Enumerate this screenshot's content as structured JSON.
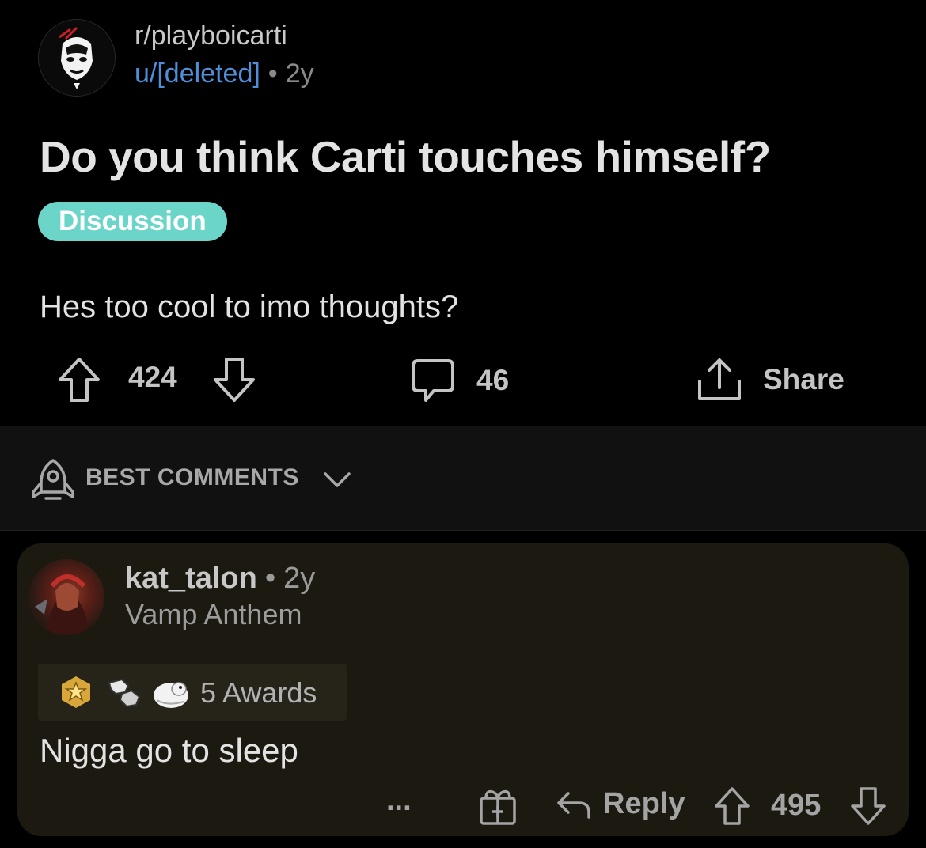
{
  "post": {
    "subreddit": "r/playboicarti",
    "author": "u/[deleted]",
    "separator": "•",
    "age": "2y",
    "title": "Do you think Carti touches himself?",
    "flair": "Discussion",
    "body": "Hes too cool to imo thoughts?",
    "upvotes": "424",
    "comments": "46",
    "share_label": "Share"
  },
  "sort": {
    "label": "BEST COMMENTS"
  },
  "comment": {
    "author": "kat_talon",
    "separator": "•",
    "age": "2y",
    "user_flair": "Vamp Anthem",
    "awards_label": "5 Awards",
    "body": "Nigga go to sleep",
    "more_label": "...",
    "reply_label": "Reply",
    "score": "495"
  },
  "colors": {
    "background": "#000000",
    "flair_bg": "#6ad5c8",
    "username_link": "#4f8fd8",
    "comment_bg": "#1b1910",
    "sort_bar_bg": "#111111"
  },
  "icons": {
    "subreddit_avatar": "subreddit-avatar-icon",
    "upvote": "arrow-up-icon",
    "downvote": "arrow-down-icon",
    "comments": "comment-bubble-icon",
    "share": "share-icon",
    "sort": "rocket-icon",
    "sort_toggle": "chevron-down-icon",
    "award_1": "gold-star-award-icon",
    "award_2": "fist-bump-award-icon",
    "award_3": "seal-award-icon",
    "gift": "gift-icon",
    "reply": "reply-arrow-icon"
  }
}
